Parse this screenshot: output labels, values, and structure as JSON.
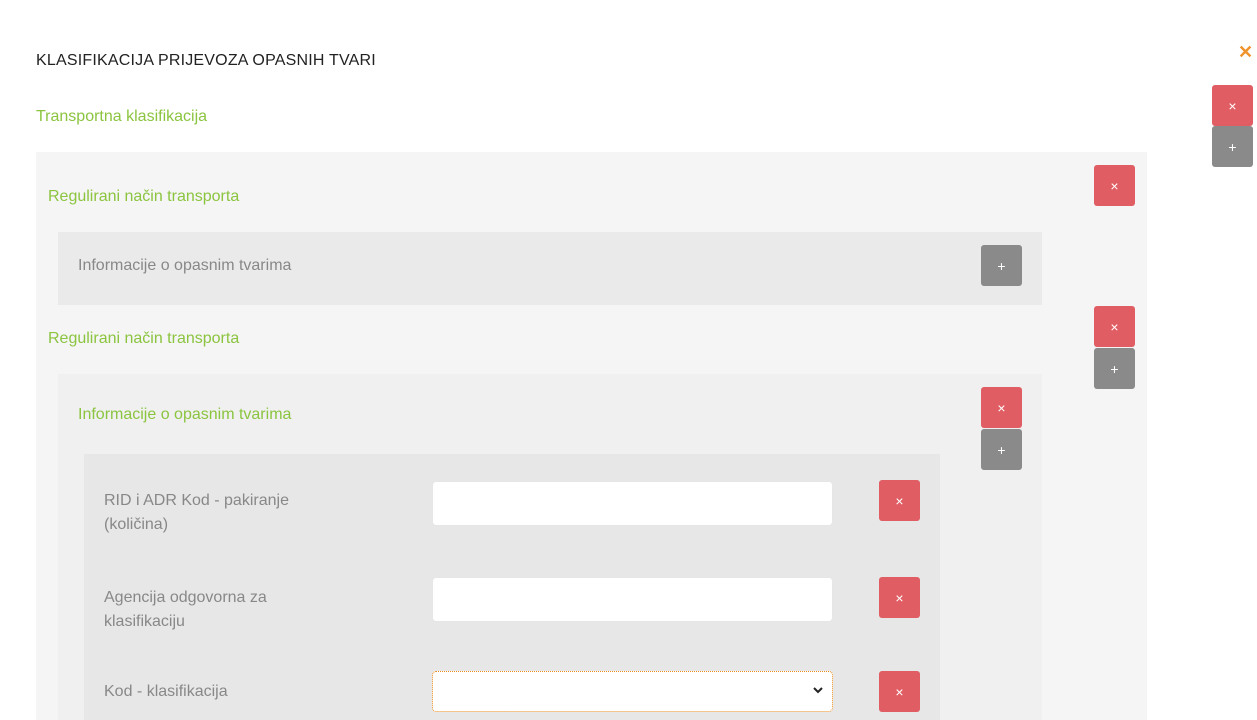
{
  "header": {
    "title": "KLASIFIKACIJA PRIJEVOZA OPASNIH TVARI",
    "close_icon": "close-icon"
  },
  "section": {
    "heading": "Transportna klasifikacija",
    "remove_label": "×",
    "add_label": "+"
  },
  "transport_1": {
    "heading": "Regulirani način transporta",
    "remove_label": "×",
    "dangerous_goods": {
      "heading": "Informacije o opasnim tvarima",
      "add_label": "+"
    }
  },
  "transport_2": {
    "heading": "Regulirani način transporta",
    "remove_label": "×",
    "add_label": "+",
    "dangerous_goods": {
      "heading": "Informacije o opasnim tvarima",
      "remove_label": "×",
      "add_label": "+",
      "fields": [
        {
          "label_line1": "RID i ADR Kod - pakiranje",
          "label_line2": "(količina)",
          "value": "",
          "remove_label": "×"
        },
        {
          "label_line1": "Agencija odgovorna za",
          "label_line2": "klasifikaciju",
          "value": "",
          "remove_label": "×"
        },
        {
          "label_line1": "Kod - klasifikacija",
          "label_line2": "",
          "selected": "",
          "remove_label": "×"
        }
      ]
    }
  },
  "colors": {
    "accent_green": "#8bc43f",
    "danger_red": "#e05d63",
    "neutral_gray": "#8a8a8a",
    "close_orange": "#f0922b",
    "focus_orange": "#e88b1c"
  }
}
